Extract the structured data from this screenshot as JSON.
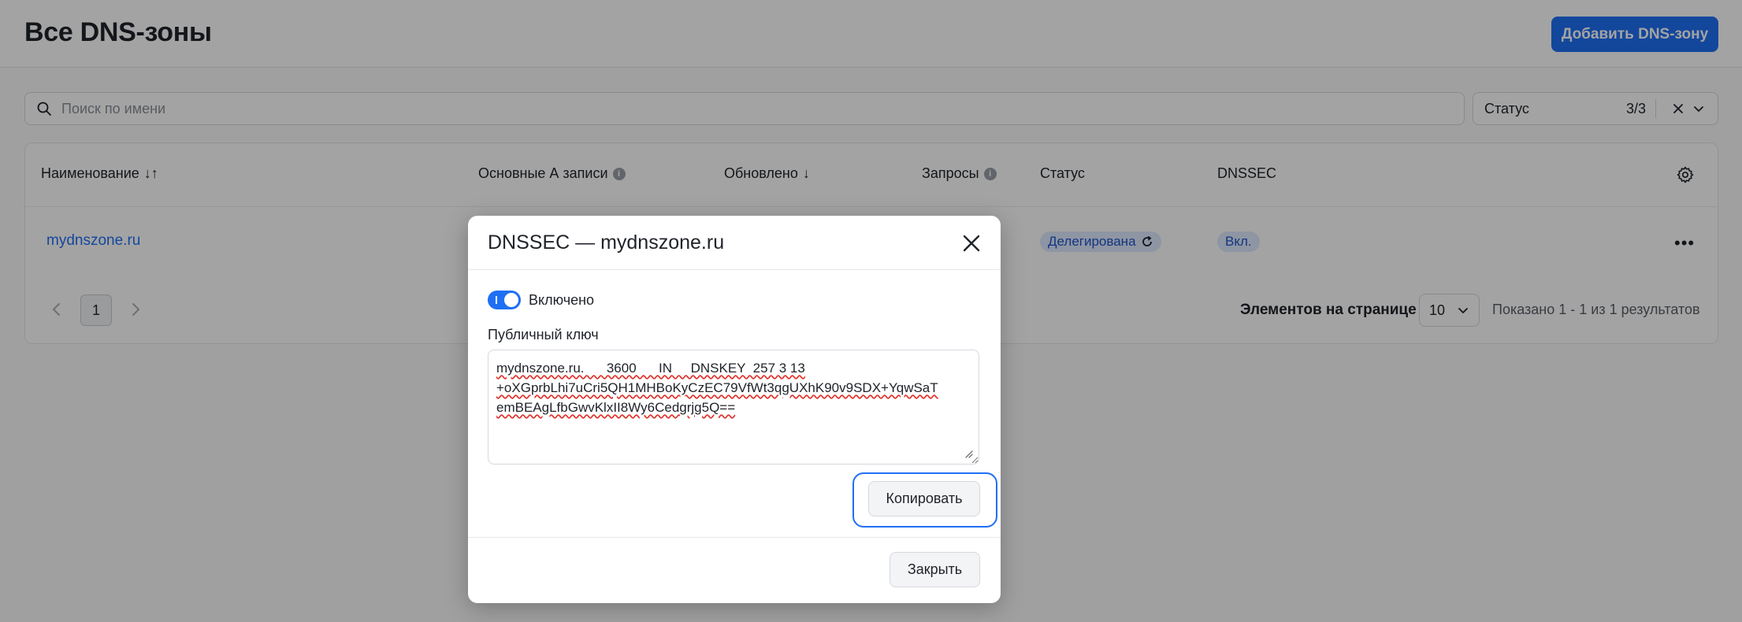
{
  "header": {
    "title": "Все DNS-зоны",
    "add_button": "Добавить DNS-зону"
  },
  "filters": {
    "search_placeholder": "Поиск по имени",
    "search_value": "",
    "status_label": "Статус",
    "status_count": "3/3"
  },
  "table": {
    "columns": {
      "name": "Наименование",
      "name_sort": "↓↑",
      "a_records": "Основные А записи",
      "updated": "Обновлено",
      "updated_sort": "↓",
      "requests": "Запросы",
      "status": "Статус",
      "dnssec": "DNSSEC"
    },
    "rows": [
      {
        "name": "mydnszone.ru",
        "status": "Делегирована",
        "dnssec": "Вкл."
      }
    ],
    "more_icon": "more-dots-icon"
  },
  "pagination": {
    "current_page": "1",
    "per_page_label": "Элементов на странице",
    "per_page_value": "10",
    "shown_text": "Показано 1 - 1 из 1 результатов"
  },
  "modal": {
    "title": "DNSSEC — mydnszone.ru",
    "toggle_label": "Включено",
    "toggle_on": true,
    "key_label": "Публичный ключ",
    "key_lines": [
      "mydnszone.ru.      3600      IN     DNSKEY  257 3 13",
      "+oXGprbLhi7uCri5QH1MHBoKyCzEC79VfWt3qgUXhK90v9SDX+YqwSaT",
      "emBEAgLfbGwvKlxII8Wy6Cedgrjg5Q=="
    ],
    "copy_button": "Копировать",
    "close_button": "Закрыть"
  },
  "colors": {
    "accent": "#1f6ff5",
    "badge_bg": "#dfe9ff",
    "badge_text": "#1f55c9",
    "overlay": "rgba(0,0,0,0.36)"
  }
}
